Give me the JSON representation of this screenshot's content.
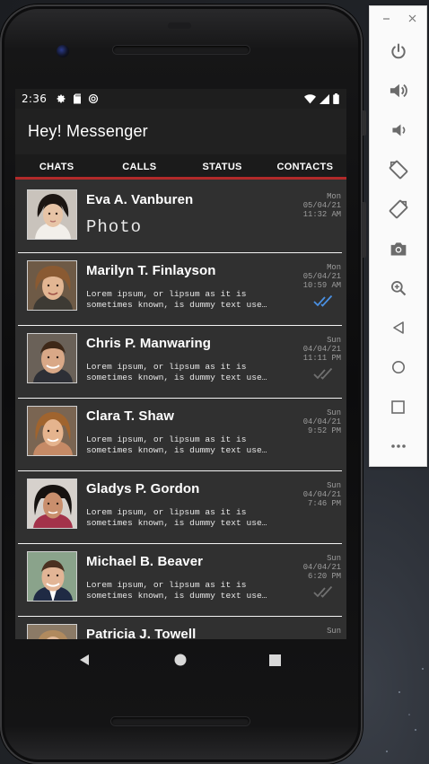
{
  "status_bar": {
    "time": "2:36"
  },
  "app": {
    "title": "Hey! Messenger"
  },
  "tabs": [
    {
      "label": "CHATS"
    },
    {
      "label": "CALLS"
    },
    {
      "label": "STATUS"
    },
    {
      "label": "CONTACTS"
    }
  ],
  "chats": [
    {
      "name": "Eva A. Vanburen",
      "preview": "Photo",
      "day": "Mon",
      "date": "05/04/21",
      "time": "11:32 AM",
      "tick": "none"
    },
    {
      "name": "Marilyn T. Finlayson",
      "preview_line1": "Lorem ipsum, or lipsum as it is",
      "preview_line2": "sometimes known, is dummy text use…",
      "day": "Mon",
      "date": "05/04/21",
      "time": "10:59 AM",
      "tick": "read"
    },
    {
      "name": "Chris P. Manwaring",
      "preview_line1": "Lorem ipsum, or lipsum as it is",
      "preview_line2": "sometimes known, is dummy text use…",
      "day": "Sun",
      "date": "04/04/21",
      "time": "11:11 PM",
      "tick": "delivered"
    },
    {
      "name": "Clara T. Shaw",
      "preview_line1": "Lorem ipsum, or lipsum as it is",
      "preview_line2": "sometimes known, is dummy text use…",
      "day": "Sun",
      "date": "04/04/21",
      "time": "9:52 PM",
      "tick": "none"
    },
    {
      "name": "Gladys P. Gordon",
      "preview_line1": "Lorem ipsum, or lipsum as it is",
      "preview_line2": "sometimes known, is dummy text use…",
      "day": "Sun",
      "date": "04/04/21",
      "time": "7:46 PM",
      "tick": "none"
    },
    {
      "name": "Michael B. Beaver",
      "preview_line1": "Lorem ipsum, or lipsum as it is",
      "preview_line2": "sometimes known, is dummy text use…",
      "day": "Sun",
      "date": "04/04/21",
      "time": "6:20 PM",
      "tick": "delivered"
    },
    {
      "name": "Patricia J. Towell",
      "day": "Sun"
    }
  ],
  "colors": {
    "tab_indicator": "#b22a2a",
    "read_tick": "#4a90e2",
    "delivered_tick": "#707070"
  },
  "icons": {
    "status_bar": [
      "gear-icon",
      "sd-card-icon",
      "sync-icon",
      "wifi-icon",
      "signal-icon",
      "battery-icon"
    ],
    "nav_bar": [
      "back-icon",
      "home-icon",
      "recents-icon"
    ],
    "emulator_toolbar": [
      "power-icon",
      "volume-up-icon",
      "volume-down-icon",
      "rotate-left-icon",
      "rotate-right-icon",
      "camera-icon",
      "zoom-icon",
      "back-icon",
      "home-icon",
      "overview-icon",
      "more-icon"
    ]
  }
}
